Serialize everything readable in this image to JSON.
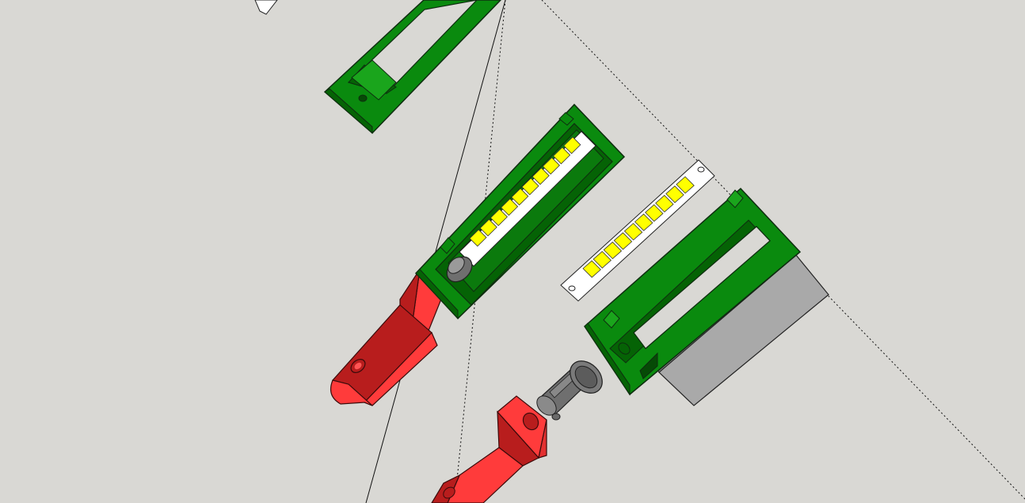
{
  "scene": {
    "kind": "3D modeling viewport",
    "background_color": "#d9d8d4",
    "colors": {
      "green_face": "#0a8a0e",
      "green_dark": "#056305",
      "green_light": "#1aa51c",
      "red_face": "#ff3b3b",
      "red_dark": "#b81d1d",
      "yellow_led": "#ffff00",
      "gray_block": "#a9a9a9",
      "gray_cylinder": "#7a7a7a",
      "white_strip": "#ffffff"
    },
    "components": [
      {
        "name": "green-enclosure-top-partial"
      },
      {
        "name": "green-enclosure-with-led-strip"
      },
      {
        "name": "loose-led-strip"
      },
      {
        "name": "green-enclosure-open-frame"
      },
      {
        "name": "gray-panel"
      },
      {
        "name": "gray-cylinder-connector"
      },
      {
        "name": "red-mount-bracket-upper"
      },
      {
        "name": "red-mount-bracket-lower"
      },
      {
        "name": "guide-lines"
      }
    ],
    "led_cells_strip_a": 10,
    "led_cells_strip_b": 10
  }
}
